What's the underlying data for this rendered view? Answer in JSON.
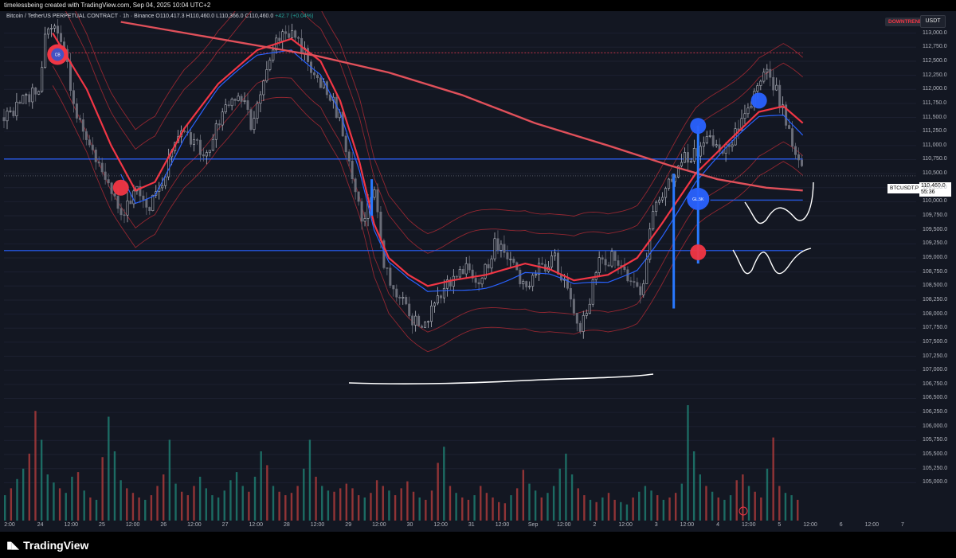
{
  "header": {
    "title": "timelessbeing created with TradingView.com, Sep 04, 2025 10:04 UTC+2"
  },
  "legend": {
    "symbol": "Bitcoin / TetherUS PERPETUAL CONTRACT · 1h · Binance",
    "open": "O110,417.3",
    "high": "H110,460.0",
    "low": "L110,366.0",
    "close": "C110,460.0",
    "change": "+42.7 (+0.04%)"
  },
  "badges": {
    "trend": "DOWNTREND",
    "currency": "USDT"
  },
  "price_tag": {
    "symbol": "BTCUSDT.P",
    "price": "110,460.0",
    "countdown": "55:36"
  },
  "markers": {
    "label_small": "CB",
    "label_circle": "GL.5K"
  },
  "footer": {
    "logo_text": "TradingView"
  },
  "colors": {
    "up": "#26a69a",
    "down": "#ef5350",
    "sma": "#f23645",
    "vwap": "#2962ff",
    "hline": "#2962ff",
    "bg": "#131722"
  },
  "icons": {
    "logo": "tradingview-logo-icon",
    "goto": "timeline-goto-icon"
  },
  "chart_data": {
    "type": "candlestick",
    "interval": "1h",
    "y_axis": {
      "range": [
        104750,
        113250
      ],
      "ticks": [
        "113,000.0",
        "112,750.0",
        "112,500.0",
        "112,250.0",
        "112,000.0",
        "111,750.0",
        "111,500.0",
        "111,250.0",
        "111,000.0",
        "110,750.0",
        "110,500.0",
        "110,250.0",
        "110,000.0",
        "109,750.0",
        "109,500.0",
        "109,250.0",
        "109,000.0",
        "108,750.0",
        "108,500.0",
        "108,250.0",
        "108,000.0",
        "107,750.0",
        "107,500.0",
        "107,250.0",
        "107,000.0",
        "106,750.0",
        "106,500.0",
        "106,250.0",
        "106,000.0",
        "105,750.0",
        "105,500.0",
        "105,250.0",
        "105,000.0"
      ]
    },
    "x_axis": {
      "ticks": [
        "2:00",
        "24",
        "12:00",
        "25",
        "12:00",
        "26",
        "12:00",
        "27",
        "12:00",
        "28",
        "12:00",
        "29",
        "12:00",
        "30",
        "12:00",
        "31",
        "12:00",
        "Sep",
        "12:00",
        "2",
        "12:00",
        "3",
        "12:00",
        "4",
        "12:00",
        "5",
        "12:00",
        "6",
        "12:00",
        "7"
      ]
    },
    "price_path": [
      {
        "t": -8,
        "p": 111500
      },
      {
        "t": 6,
        "p": 112000
      },
      {
        "t": 10,
        "p": 113200
      },
      {
        "t": 16,
        "p": 112800
      },
      {
        "t": 22,
        "p": 111500
      },
      {
        "t": 28,
        "p": 111000
      },
      {
        "t": 34,
        "p": 110400
      },
      {
        "t": 40,
        "p": 109700
      },
      {
        "t": 46,
        "p": 110200
      },
      {
        "t": 52,
        "p": 109900
      },
      {
        "t": 58,
        "p": 110500
      },
      {
        "t": 64,
        "p": 111300
      },
      {
        "t": 70,
        "p": 111000
      },
      {
        "t": 76,
        "p": 110900
      },
      {
        "t": 82,
        "p": 111600
      },
      {
        "t": 88,
        "p": 112000
      },
      {
        "t": 94,
        "p": 111300
      },
      {
        "t": 100,
        "p": 112500
      },
      {
        "t": 106,
        "p": 113000
      },
      {
        "t": 112,
        "p": 112900
      },
      {
        "t": 118,
        "p": 112400
      },
      {
        "t": 124,
        "p": 112000
      },
      {
        "t": 130,
        "p": 111500
      },
      {
        "t": 136,
        "p": 110200
      },
      {
        "t": 140,
        "p": 109600
      },
      {
        "t": 144,
        "p": 110300
      },
      {
        "t": 148,
        "p": 108800
      },
      {
        "t": 152,
        "p": 108500
      },
      {
        "t": 158,
        "p": 108000
      },
      {
        "t": 164,
        "p": 107700
      },
      {
        "t": 170,
        "p": 108300
      },
      {
        "t": 176,
        "p": 108600
      },
      {
        "t": 182,
        "p": 108800
      },
      {
        "t": 188,
        "p": 108600
      },
      {
        "t": 194,
        "p": 109300
      },
      {
        "t": 200,
        "p": 108900
      },
      {
        "t": 206,
        "p": 108500
      },
      {
        "t": 212,
        "p": 108800
      },
      {
        "t": 218,
        "p": 109000
      },
      {
        "t": 224,
        "p": 108300
      },
      {
        "t": 228,
        "p": 107700
      },
      {
        "t": 232,
        "p": 108200
      },
      {
        "t": 236,
        "p": 108900
      },
      {
        "t": 242,
        "p": 109000
      },
      {
        "t": 248,
        "p": 108700
      },
      {
        "t": 254,
        "p": 108200
      },
      {
        "t": 258,
        "p": 109800
      },
      {
        "t": 264,
        "p": 110300
      },
      {
        "t": 270,
        "p": 110700
      },
      {
        "t": 276,
        "p": 110900
      },
      {
        "t": 282,
        "p": 111100
      },
      {
        "t": 288,
        "p": 110900
      },
      {
        "t": 294,
        "p": 111300
      },
      {
        "t": 300,
        "p": 111900
      },
      {
        "t": 304,
        "p": 112300
      },
      {
        "t": 308,
        "p": 112100
      },
      {
        "t": 312,
        "p": 111600
      },
      {
        "t": 316,
        "p": 111000
      },
      {
        "t": 320,
        "p": 110460
      }
    ],
    "sma_path": [
      {
        "t": 12,
        "p": 113000
      },
      {
        "t": 26,
        "p": 112000
      },
      {
        "t": 36,
        "p": 111000
      },
      {
        "t": 46,
        "p": 110200
      },
      {
        "t": 54,
        "p": 110350
      },
      {
        "t": 66,
        "p": 111300
      },
      {
        "t": 80,
        "p": 112100
      },
      {
        "t": 96,
        "p": 112700
      },
      {
        "t": 110,
        "p": 112900
      },
      {
        "t": 122,
        "p": 112500
      },
      {
        "t": 130,
        "p": 111800
      },
      {
        "t": 138,
        "p": 110700
      },
      {
        "t": 144,
        "p": 109600
      },
      {
        "t": 150,
        "p": 109000
      },
      {
        "t": 158,
        "p": 108700
      },
      {
        "t": 166,
        "p": 108500
      },
      {
        "t": 176,
        "p": 108600
      },
      {
        "t": 190,
        "p": 108700
      },
      {
        "t": 206,
        "p": 108900
      },
      {
        "t": 216,
        "p": 108800
      },
      {
        "t": 226,
        "p": 108600
      },
      {
        "t": 240,
        "p": 108700
      },
      {
        "t": 252,
        "p": 109000
      },
      {
        "t": 262,
        "p": 109600
      },
      {
        "t": 276,
        "p": 110500
      },
      {
        "t": 290,
        "p": 111100
      },
      {
        "t": 302,
        "p": 111600
      },
      {
        "t": 312,
        "p": 111700
      },
      {
        "t": 320,
        "p": 111400
      }
    ],
    "long_ma_path": [
      {
        "t": 40,
        "p": 113200
      },
      {
        "t": 80,
        "p": 112900
      },
      {
        "t": 120,
        "p": 112600
      },
      {
        "t": 150,
        "p": 112300
      },
      {
        "t": 180,
        "p": 111900
      },
      {
        "t": 210,
        "p": 111400
      },
      {
        "t": 240,
        "p": 111000
      },
      {
        "t": 265,
        "p": 110650
      },
      {
        "t": 285,
        "p": 110400
      },
      {
        "t": 305,
        "p": 110250
      },
      {
        "t": 320,
        "p": 110200
      }
    ],
    "h_lines": [
      {
        "p": 110760,
        "t_start": -8,
        "t_end": 320
      },
      {
        "p": 109130,
        "t_start": -8,
        "t_end": 320
      },
      {
        "p": 110030,
        "t_start": 282,
        "t_end": 320
      },
      {
        "p": 112650,
        "t_start": 16,
        "t_end": 320
      }
    ],
    "signals": [
      {
        "t": 14,
        "p": 112620,
        "color": "#f23645",
        "label": "CB"
      },
      {
        "t": 40,
        "p": 110250,
        "color": "#f23645",
        "label": ""
      },
      {
        "t": 277,
        "p": 111350,
        "color": "#2962ff",
        "label": ""
      },
      {
        "t": 277,
        "p": 110050,
        "color": "#2962ff",
        "label": "GL.5K"
      },
      {
        "t": 277,
        "p": 109100,
        "color": "#f23645",
        "label": ""
      },
      {
        "t": 302,
        "p": 111800,
        "color": "#2962ff",
        "label": ""
      }
    ],
    "volume": [
      22,
      28,
      36,
      45,
      58,
      95,
      70,
      40,
      33,
      28,
      24,
      38,
      42,
      26,
      20,
      18,
      55,
      90,
      60,
      35,
      28,
      24,
      20,
      18,
      22,
      30,
      40,
      70,
      32,
      25,
      22,
      30,
      38,
      28,
      22,
      20,
      26,
      35,
      42,
      30,
      25,
      38,
      60,
      48,
      30,
      25,
      22,
      24,
      30,
      45,
      70,
      38,
      30,
      26,
      25,
      28,
      32,
      28,
      22,
      20,
      24,
      35,
      30,
      26,
      22,
      28,
      34,
      25,
      20,
      18,
      26,
      50,
      64,
      30,
      24,
      20,
      18,
      22,
      30,
      24,
      20,
      16,
      15,
      22,
      28,
      44,
      32,
      26,
      20,
      24,
      30,
      45,
      58,
      40,
      28,
      22,
      18,
      16,
      20,
      24,
      18,
      16,
      14,
      20,
      25,
      30,
      26,
      22,
      18,
      20,
      24,
      32,
      100,
      60,
      40,
      30,
      25,
      20,
      18,
      22,
      35,
      40,
      30,
      25,
      20,
      45,
      72,
      30,
      24,
      22,
      18
    ]
  }
}
